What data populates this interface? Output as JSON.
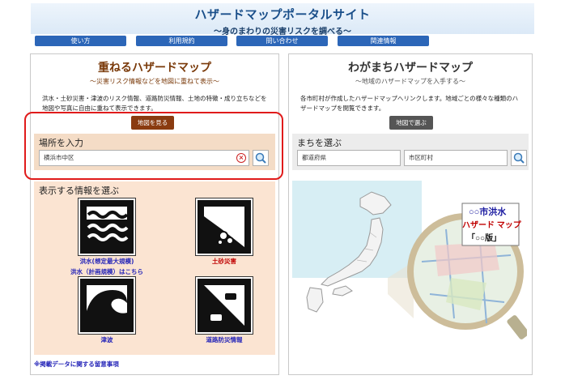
{
  "header": {
    "title": "ハザードマップポータルサイト",
    "subtitle": "～身のまわりの災害リスクを調べる～"
  },
  "nav": [
    "使い方",
    "利用規約",
    "問い合わせ",
    "関連情報"
  ],
  "left_panel": {
    "title": "重ねるハザードマップ",
    "subtitle": "～災害リスク情報などを地図に重ねて表示～",
    "description": "洪水・土砂災害・津波のリスク情報、道路防災情報、土地の特徴・成り立ちなどを地図や写真に自由に重ねて表示できます。",
    "button": "地図を見る",
    "location_label": "場所を入力",
    "location_value": "横浜市中区",
    "info_label": "表示する情報を選ぶ",
    "tiles": {
      "flood_line1": "洪水(想定最大規模)",
      "flood_line2": "洪水（計画規模）はこちら",
      "landslide": "土砂災害",
      "tsunami": "津波",
      "road": "道路防災情報"
    },
    "footnote": "※掲載データに関する留意事項"
  },
  "right_panel": {
    "title": "わがまちハザードマップ",
    "subtitle": "～地域のハザードマップを入手する～",
    "description": "各市町村が作成したハザードマップへリンクします。地域ごとの様々な種類のハザードマップを閲覧できます。",
    "button": "地図で選ぶ",
    "town_label": "まちを選ぶ",
    "prefecture": "都道府県",
    "municipality": "市区町村",
    "magnifier_line1": "○○市洪水",
    "magnifier_line2": "ハザード マップ",
    "magnifier_line3": "「○○版」"
  },
  "colors": {
    "nav_blue": "#2c66b8",
    "brown": "#8a3b10",
    "highlight_red": "#e01b1b",
    "tile_bg": "#fbe4d2"
  },
  "icons": [
    "search-icon",
    "clear-icon",
    "flood-icon",
    "landslide-icon",
    "tsunami-icon",
    "road-hazard-icon",
    "magnifier-icon"
  ]
}
